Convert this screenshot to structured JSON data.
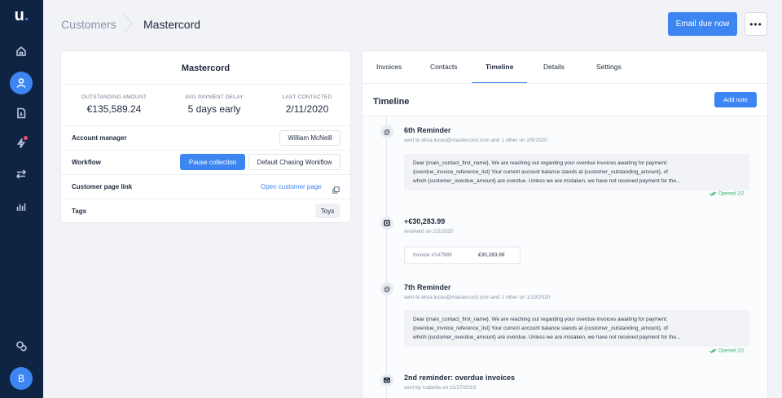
{
  "app": {
    "logo": "u",
    "logo_dot": ".",
    "user_initial": "B"
  },
  "nav": {
    "items": [
      {
        "icon": "home-icon"
      },
      {
        "icon": "customers-icon"
      },
      {
        "icon": "invoice-icon"
      },
      {
        "icon": "flash-icon"
      },
      {
        "icon": "transfer-icon"
      },
      {
        "icon": "chart-icon"
      }
    ],
    "bottom": {
      "icon": "chat-icon"
    }
  },
  "header": {
    "breadcrumb_parent": "Customers",
    "breadcrumb_current": "Mastercord",
    "email_button": "Email due now",
    "more_button": "•••"
  },
  "customer": {
    "name": "Mastercord",
    "stats": [
      {
        "label": "OUTSTANDING AMOUNT",
        "value": "€135,589.24"
      },
      {
        "label": "AVG PAYMENT DELAY",
        "value": "5 days early"
      },
      {
        "label": "LAST CONTACTED",
        "value": "2/11/2020"
      }
    ],
    "account_manager_label": "Account manager",
    "account_manager_value": "William McNeill",
    "workflow_label": "Workflow",
    "pause_button": "Pause collection",
    "workflow_value": "Default Chasing Workflow",
    "page_link_label": "Customer page link",
    "page_link_text": "Open customer page",
    "tags_label": "Tags",
    "tag": "Toys"
  },
  "tabs": [
    {
      "label": "Invoices"
    },
    {
      "label": "Contacts"
    },
    {
      "label": "Timeline"
    },
    {
      "label": "Details"
    },
    {
      "label": "Settings"
    }
  ],
  "timeline": {
    "title": "Timeline",
    "add_note": "Add note",
    "events": [
      {
        "icon": "@",
        "title": "6th Reminder",
        "subtitle": "sent to elisa.lucas@mastercord.com and 1 other on 2/5/2020",
        "body": [
          "Dear {main_contact_first_name}, We are reaching out regarding your overdue invoices awaiting for payment:",
          "{overdue_invoice_reference_list} Your current account balance stands at {customer_outstanding_amount}, of",
          "which {customer_overdue_amount} are overdue. Unless we are mistaken, we have not received payment for the..."
        ],
        "opened": "Opened 2/2"
      },
      {
        "title": "+€30,283.99",
        "subtitle": "received on 2/2/2020",
        "invoice_number": "Invoice #147989",
        "invoice_amount": "€30,283.99"
      },
      {
        "icon": "@",
        "title": "7th Reminder",
        "subtitle": "sent to elisa.lucas@mastercord.com and 1 other on 1/19/2020",
        "body": [
          "Dear {main_contact_first_name}, We are reaching out regarding your overdue invoices awaiting for payment:",
          "{overdue_invoice_reference_list} Your current account balance stands at {customer_outstanding_amount}, of",
          "which {customer_overdue_amount} are overdue. Unless we are mistaken, we have not received payment for the..."
        ],
        "opened": "Opened 2/2"
      },
      {
        "title": "2nd reminder: overdue invoices",
        "subtitle": "sent by Isabella on 11/27/2019"
      }
    ]
  },
  "colors": {
    "sidebar": "#0f2443",
    "accent": "#3d86f2",
    "success": "#35b46b",
    "alert": "#f0506e"
  }
}
